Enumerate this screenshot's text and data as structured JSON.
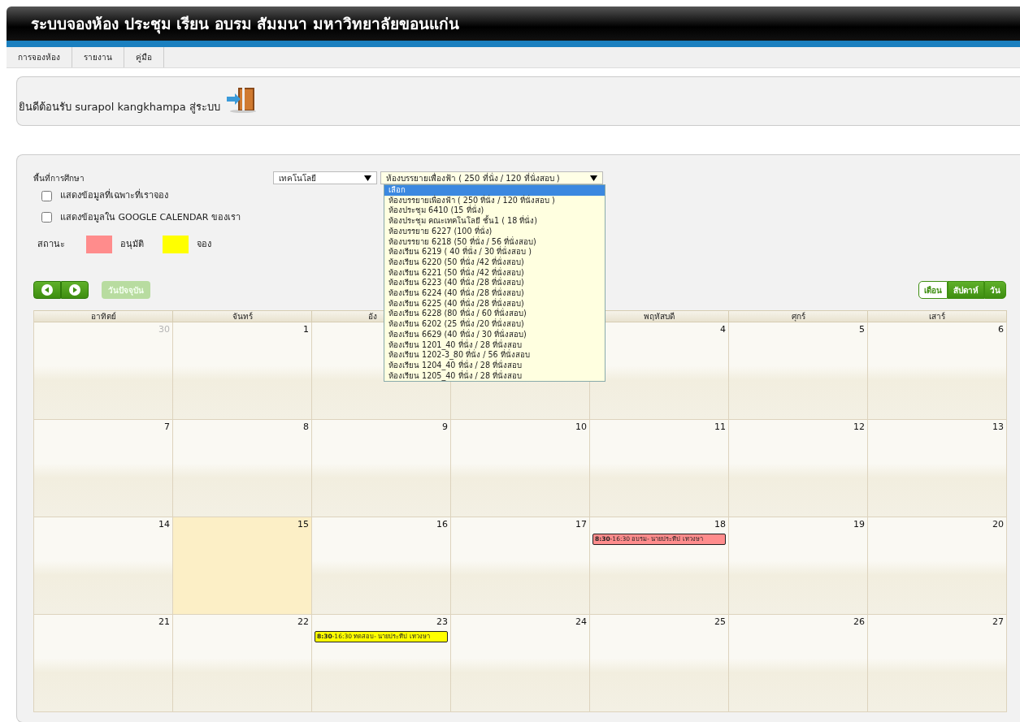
{
  "title": "ระบบจองห้อง ประชุม เรียน อบรม สัมมนา มหาวิทยาลัยขอนแก่น",
  "menu": [
    {
      "label": "การจองห้อง"
    },
    {
      "label": "รายงาน"
    },
    {
      "label": "คู่มือ"
    }
  ],
  "welcome": "ยินดีต้อนรับ surapol kangkhampa สู่ระบบ",
  "filters": {
    "area_label": "พื้นที่การศึกษา",
    "area_value": "เทคโนโลยี",
    "room_value": "ห้องบรรยายเพื่องฟ้า ( 250 ที่นั่ง / 120 ที่นั่งสอบ )",
    "room_options": [
      {
        "label": "เลือก",
        "selected": true
      },
      {
        "label": "ห้องบรรยายเพื่องฟ้า ( 250 ที่นั่ง / 120 ที่นั่งสอบ )",
        "selected": false
      },
      {
        "label": "ห้องประชุม 6410 (15 ที่นั่ง)",
        "selected": false
      },
      {
        "label": "ห้องประชุม คณะเทคโนโลยี ชั้น1 ( 18 ที่นั่ง)",
        "selected": false
      },
      {
        "label": "ห้องบรรยาย 6227 (100 ที่นั่ง)",
        "selected": false
      },
      {
        "label": "ห้องบรรยาย 6218 (50 ที่นั่ง / 56 ที่นั่งสอบ)",
        "selected": false
      },
      {
        "label": "ห้องเรียน 6219 ( 40 ที่นั่ง / 30 ที่นั่งสอบ )",
        "selected": false
      },
      {
        "label": "ห้องเรียน 6220 (50 ที่นั่ง /42 ที่นั่งสอบ)",
        "selected": false
      },
      {
        "label": "ห้องเรียน 6221 (50 ที่นั่ง /42 ที่นั่งสอบ)",
        "selected": false
      },
      {
        "label": "ห้องเรียน 6223 (40 ที่นั่ง /28 ที่นั่งสอบ)",
        "selected": false
      },
      {
        "label": "ห้องเรียน 6224 (40 ที่นั่ง /28 ที่นั่งสอบ)",
        "selected": false
      },
      {
        "label": "ห้องเรียน 6225 (40 ที่นั่ง /28 ที่นั่งสอบ)",
        "selected": false
      },
      {
        "label": "ห้องเรียน 6228 (80 ที่นั่ง / 60 ที่นั่งสอบ)",
        "selected": false
      },
      {
        "label": "ห้องเรียน 6202 (25 ที่นั่ง /20 ที่นั่งสอบ)",
        "selected": false
      },
      {
        "label": "ห้องเรียน 6629 (40 ที่นั่ง / 30 ที่นั่งสอบ)",
        "selected": false
      },
      {
        "label": "ห้องเรียน 1201_40 ที่นั่ง / 28 ที่นั่งสอบ",
        "selected": false
      },
      {
        "label": "ห้องเรียน 1202-3_80 ที่นั่ง / 56 ที่นั่งสอบ",
        "selected": false
      },
      {
        "label": "ห้องเรียน 1204_40 ที่นั่ง / 28 ที่นั่งสอบ",
        "selected": false
      },
      {
        "label": "ห้องเรียน 1205_40 ที่นั่ง / 28 ที่นั่งสอบ",
        "selected": false
      }
    ],
    "checkboxes": [
      {
        "label": "แสดงข้อมูลที่เฉพาะที่เราจอง",
        "checked": false
      },
      {
        "label": "แสดงข้อมูลใน GOOGLE CALENDAR ของเรา",
        "checked": false
      }
    ]
  },
  "legend": {
    "label": "สถานะ",
    "items": [
      {
        "label": "อนุมัติ",
        "color": "#ff8c8c"
      },
      {
        "label": "จอง",
        "color": "#ffff00"
      }
    ]
  },
  "today_button": {
    "label": "วันปัจจุบัน",
    "disabled": true
  },
  "views": [
    {
      "label": "เดือน",
      "selected": true
    },
    {
      "label": "สัปดาห์",
      "selected": false
    },
    {
      "label": "วัน",
      "selected": false
    }
  ],
  "weekdays": [
    {
      "label": "อาทิตย์",
      "kind": "full"
    },
    {
      "label": "จันทร์",
      "kind": "full"
    },
    {
      "label": "อัง",
      "kind": "covered"
    },
    {
      "label": "พฤหัสบดี",
      "kind": "full"
    },
    {
      "label": "ศุกร์",
      "kind": "full"
    },
    {
      "label": "เสาร์",
      "kind": "full"
    }
  ],
  "weeks": [
    [
      {
        "day": "30",
        "other_month": true,
        "today": false
      },
      {
        "day": "1",
        "other_month": false,
        "today": false
      },
      {
        "today": false
      },
      {
        "today": false
      },
      {
        "day": "4",
        "other_month": false,
        "today": false
      },
      {
        "day": "5",
        "other_month": false,
        "today": false
      },
      {
        "day": "6",
        "other_month": false,
        "today": false
      }
    ],
    [
      {
        "day": "7",
        "other_month": false,
        "today": false
      },
      {
        "day": "8",
        "other_month": false,
        "today": false
      },
      {
        "day": "9",
        "other_month": false,
        "today": false
      },
      {
        "day": "10",
        "other_month": false,
        "today": false
      },
      {
        "day": "11",
        "other_month": false,
        "today": false
      },
      {
        "day": "12",
        "other_month": false,
        "today": false
      },
      {
        "day": "13",
        "other_month": false,
        "today": false
      }
    ],
    [
      {
        "day": "14",
        "other_month": false,
        "today": false
      },
      {
        "day": "15",
        "other_month": false,
        "today": true
      },
      {
        "day": "16",
        "other_month": false,
        "today": false
      },
      {
        "day": "17",
        "other_month": false,
        "today": false
      },
      {
        "day": "18",
        "other_month": false,
        "today": false,
        "events": [
          {
            "text": "**8:30**-16:30 อบรม- นายประทีป เทวงษา",
            "color": "#ff8c8c"
          }
        ]
      },
      {
        "day": "19",
        "other_month": false,
        "today": false
      },
      {
        "day": "20",
        "other_month": false,
        "today": false
      }
    ],
    [
      {
        "day": "21",
        "other_month": false,
        "today": false
      },
      {
        "day": "22",
        "other_month": false,
        "today": false
      },
      {
        "day": "23",
        "other_month": false,
        "today": false,
        "events": [
          {
            "text": "**8:30**-16:30 ทดสอบ- นายประทีป เทวงษา",
            "color": "#ffff00"
          }
        ]
      },
      {
        "day": "24",
        "other_month": false,
        "today": false
      },
      {
        "day": "25",
        "other_month": false,
        "today": false
      },
      {
        "day": "26",
        "other_month": false,
        "today": false
      },
      {
        "day": "27",
        "other_month": false,
        "today": false
      }
    ]
  ]
}
